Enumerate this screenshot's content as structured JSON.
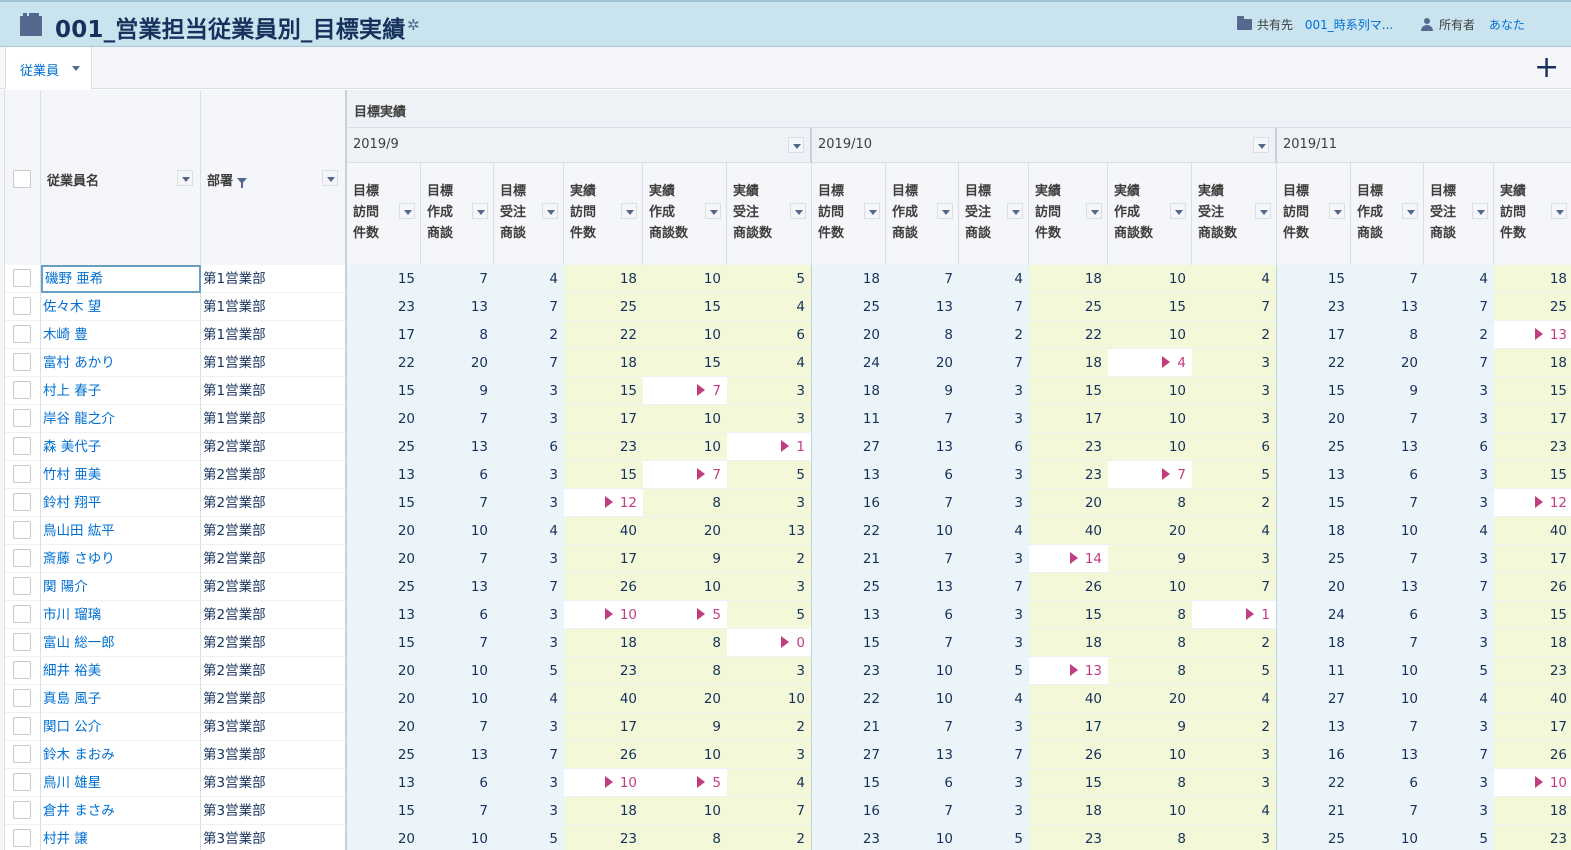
{
  "header": {
    "title": "001_営業担当従業員別_目標実績",
    "shared_label": "共有先",
    "shared_value": "001_時系列マ...",
    "owner_label": "所有者",
    "owner_value": "あなた"
  },
  "tabs": [
    {
      "label": "従業員"
    }
  ],
  "table": {
    "col_name": "従業員名",
    "col_dept": "部署",
    "group_label": "目標実績",
    "months": [
      "2019/9",
      "2019/10",
      "2019/11"
    ],
    "sub_headers": [
      [
        "目標",
        "訪問",
        "件数"
      ],
      [
        "目標",
        "作成",
        "商談"
      ],
      [
        "目標",
        "受注",
        "商談"
      ],
      [
        "実績",
        "訪問",
        "件数"
      ],
      [
        "実績",
        "作成",
        "商談数"
      ],
      [
        "実績",
        "受注",
        "商談数"
      ]
    ],
    "rows": [
      {
        "name": "磯野 亜希",
        "dept": "第1営業部",
        "v": [
          [
            15,
            7,
            4,
            18,
            10,
            5
          ],
          [
            18,
            7,
            4,
            18,
            10,
            4
          ],
          [
            15,
            7,
            4,
            18
          ]
        ],
        "alerts": []
      },
      {
        "name": "佐々木 望",
        "dept": "第1営業部",
        "v": [
          [
            23,
            13,
            7,
            25,
            15,
            4
          ],
          [
            25,
            13,
            7,
            25,
            15,
            7
          ],
          [
            23,
            13,
            7,
            25
          ]
        ],
        "alerts": []
      },
      {
        "name": "木崎 豊",
        "dept": "第1営業部",
        "v": [
          [
            17,
            8,
            2,
            22,
            10,
            6
          ],
          [
            20,
            8,
            2,
            22,
            10,
            2
          ],
          [
            17,
            8,
            2,
            13
          ]
        ],
        "alerts": [
          [
            2,
            3
          ]
        ]
      },
      {
        "name": "富村 あかり",
        "dept": "第1営業部",
        "v": [
          [
            22,
            20,
            7,
            18,
            15,
            4
          ],
          [
            24,
            20,
            7,
            18,
            4,
            3
          ],
          [
            22,
            20,
            7,
            18
          ]
        ],
        "alerts": [
          [
            1,
            4
          ]
        ]
      },
      {
        "name": "村上 春子",
        "dept": "第1営業部",
        "v": [
          [
            15,
            9,
            3,
            15,
            7,
            3
          ],
          [
            18,
            9,
            3,
            15,
            10,
            3
          ],
          [
            15,
            9,
            3,
            15
          ]
        ],
        "alerts": [
          [
            0,
            4
          ]
        ]
      },
      {
        "name": "岸谷 龍之介",
        "dept": "第1営業部",
        "v": [
          [
            20,
            7,
            3,
            17,
            10,
            3
          ],
          [
            11,
            7,
            3,
            17,
            10,
            3
          ],
          [
            20,
            7,
            3,
            17
          ]
        ],
        "alerts": []
      },
      {
        "name": "森 美代子",
        "dept": "第2営業部",
        "v": [
          [
            25,
            13,
            6,
            23,
            10,
            1
          ],
          [
            27,
            13,
            6,
            23,
            10,
            6
          ],
          [
            25,
            13,
            6,
            23
          ]
        ],
        "alerts": [
          [
            0,
            5
          ]
        ]
      },
      {
        "name": "竹村 亜美",
        "dept": "第2営業部",
        "v": [
          [
            13,
            6,
            3,
            15,
            7,
            5
          ],
          [
            13,
            6,
            3,
            23,
            7,
            5
          ],
          [
            13,
            6,
            3,
            15
          ]
        ],
        "alerts": [
          [
            0,
            4
          ],
          [
            1,
            4
          ]
        ]
      },
      {
        "name": "鈴村 翔平",
        "dept": "第2営業部",
        "v": [
          [
            15,
            7,
            3,
            12,
            8,
            3
          ],
          [
            16,
            7,
            3,
            20,
            8,
            2
          ],
          [
            15,
            7,
            3,
            12
          ]
        ],
        "alerts": [
          [
            0,
            3
          ],
          [
            2,
            3
          ]
        ]
      },
      {
        "name": "鳥山田 紘平",
        "dept": "第2営業部",
        "v": [
          [
            20,
            10,
            4,
            40,
            20,
            13
          ],
          [
            22,
            10,
            4,
            40,
            20,
            4
          ],
          [
            18,
            10,
            4,
            40
          ]
        ],
        "alerts": []
      },
      {
        "name": "斎藤 さゆり",
        "dept": "第2営業部",
        "v": [
          [
            20,
            7,
            3,
            17,
            9,
            2
          ],
          [
            21,
            7,
            3,
            14,
            9,
            3
          ],
          [
            25,
            7,
            3,
            17
          ]
        ],
        "alerts": [
          [
            1,
            3
          ]
        ]
      },
      {
        "name": "関 陽介",
        "dept": "第2営業部",
        "v": [
          [
            25,
            13,
            7,
            26,
            10,
            3
          ],
          [
            25,
            13,
            7,
            26,
            10,
            7
          ],
          [
            20,
            13,
            7,
            26
          ]
        ],
        "alerts": []
      },
      {
        "name": "市川 瑠璃",
        "dept": "第2営業部",
        "v": [
          [
            13,
            6,
            3,
            10,
            5,
            5
          ],
          [
            13,
            6,
            3,
            15,
            8,
            1
          ],
          [
            24,
            6,
            3,
            15
          ]
        ],
        "alerts": [
          [
            0,
            3
          ],
          [
            0,
            4
          ],
          [
            1,
            5
          ]
        ]
      },
      {
        "name": "富山 総一郎",
        "dept": "第2営業部",
        "v": [
          [
            15,
            7,
            3,
            18,
            8,
            0
          ],
          [
            15,
            7,
            3,
            18,
            8,
            2
          ],
          [
            18,
            7,
            3,
            18
          ]
        ],
        "alerts": [
          [
            0,
            5
          ]
        ]
      },
      {
        "name": "細井 裕美",
        "dept": "第2営業部",
        "v": [
          [
            20,
            10,
            5,
            23,
            8,
            3
          ],
          [
            23,
            10,
            5,
            13,
            8,
            5
          ],
          [
            11,
            10,
            5,
            23
          ]
        ],
        "alerts": [
          [
            1,
            3
          ]
        ]
      },
      {
        "name": "真島 風子",
        "dept": "第2営業部",
        "v": [
          [
            20,
            10,
            4,
            40,
            20,
            10
          ],
          [
            22,
            10,
            4,
            40,
            20,
            4
          ],
          [
            27,
            10,
            4,
            40
          ]
        ],
        "alerts": []
      },
      {
        "name": "関口 公介",
        "dept": "第3営業部",
        "v": [
          [
            20,
            7,
            3,
            17,
            9,
            2
          ],
          [
            21,
            7,
            3,
            17,
            9,
            2
          ],
          [
            13,
            7,
            3,
            17
          ]
        ],
        "alerts": []
      },
      {
        "name": "鈴木 まおみ",
        "dept": "第3営業部",
        "v": [
          [
            25,
            13,
            7,
            26,
            10,
            3
          ],
          [
            27,
            13,
            7,
            26,
            10,
            3
          ],
          [
            16,
            13,
            7,
            26
          ]
        ],
        "alerts": []
      },
      {
        "name": "鳥川 雄星",
        "dept": "第3営業部",
        "v": [
          [
            13,
            6,
            3,
            10,
            5,
            4
          ],
          [
            15,
            6,
            3,
            15,
            8,
            3
          ],
          [
            22,
            6,
            3,
            10
          ]
        ],
        "alerts": [
          [
            0,
            3
          ],
          [
            0,
            4
          ],
          [
            2,
            3
          ]
        ]
      },
      {
        "name": "倉井 まさみ",
        "dept": "第3営業部",
        "v": [
          [
            15,
            7,
            3,
            18,
            10,
            7
          ],
          [
            16,
            7,
            3,
            18,
            10,
            4
          ],
          [
            21,
            7,
            3,
            18
          ]
        ],
        "alerts": []
      },
      {
        "name": "村井 譲",
        "dept": "第3営業部",
        "v": [
          [
            20,
            10,
            5,
            23,
            8,
            2
          ],
          [
            23,
            10,
            5,
            23,
            8,
            3
          ],
          [
            25,
            10,
            5,
            23
          ]
        ],
        "alerts": []
      }
    ]
  }
}
